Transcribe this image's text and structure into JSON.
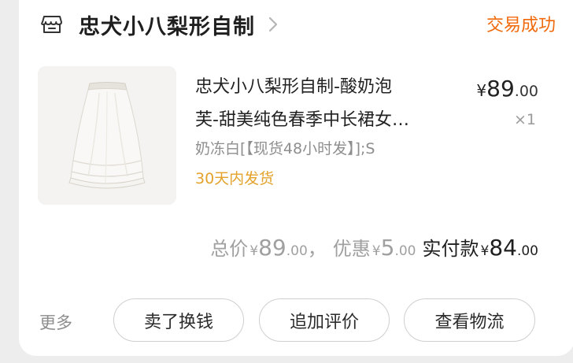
{
  "header": {
    "store_icon": "store-icon",
    "store_name": "忠犬小八梨形自制",
    "chevron_icon": "chevron-right-icon",
    "status": "交易成功",
    "status_color": "#f06a0c"
  },
  "item": {
    "image_icon": "skirt-product-image",
    "title_line1": "忠犬小八梨形自制-酸奶泡",
    "title_line2": "芙-甜美纯色春季中长裙女…",
    "sku": "奶冻白[【现货48小时发】];S",
    "shipping": "30天内发货",
    "shipping_color": "#e3a22a",
    "price_symbol": "¥",
    "price_int": "89",
    "price_dec": ".00",
    "quantity": "×1"
  },
  "summary": {
    "total_label": "总价",
    "total_symbol": "¥",
    "total_int": "89",
    "total_dec": ".00",
    "separator": "，",
    "discount_label": "优惠",
    "discount_symbol": "¥",
    "discount_int": "5",
    "discount_dec": ".00",
    "paid_label": "实付款",
    "paid_symbol": "¥",
    "paid_int": "84",
    "paid_dec": ".00"
  },
  "actions": {
    "more": "更多",
    "sell_label": "卖了换钱",
    "review_label": "追加评价",
    "logistics_label": "查看物流"
  }
}
